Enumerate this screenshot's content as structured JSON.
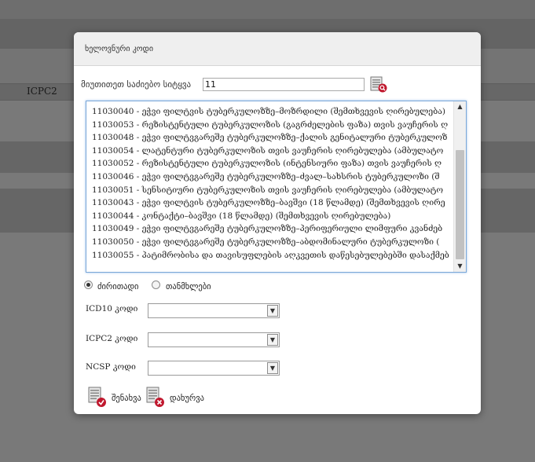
{
  "background": {
    "column_label": "ICPC2"
  },
  "dialog": {
    "title": "ხელოვნური კოდი",
    "search": {
      "label": "მიუთითეთ საძიებო სიტყვა",
      "value": "11"
    },
    "codes": [
      "11030040 - ეჭვი ფილტვის ტუბერკულოზზე–მოზრდილი (შემთხვევის ღირებულება)",
      "11030053 - რეზისტენტული ტუბერკულოზის (გაგრძელების ფაზა) თვის ვაუჩერის ღ",
      "11030048 - ეჭვი ფილტვგარეშე ტუბერკულოზზე–ქალის გენიტალური ტუბერკულოზ",
      "11030054 - ლატენტური ტუბერკულოზის თვის ვაუჩერის ღირებულება (ამბულატო",
      "11030052 - რეზისტენტული ტუბერკულოზის (ინტენსიური ფაზა) თვის ვაუჩერის ღ",
      "11030046 - ეჭვი ფილტვგარეშე ტუბერკულოზზე–ძვალ–სახსრის ტუბერკულოზი (შ",
      "11030051 - სენსიტიური ტუბერკულოზის თვის ვაუჩერის ღირებულება (ამბულატო",
      "11030043 - ეჭვი ფილტვის ტუბერკულოზზე–ბავშვი (18 წლამდე) (შემთხვევის ღირე",
      "11030044 - კონტაქტი–ბავშვი (18 წლამდე) (შემთხვევის ღირებულება)",
      "11030049 - ეჭვი ფილტვგარეშე ტუბერკულოზზე–პერიფერიული ლიმფური კვანძებ",
      "11030050 - ეჭვი ფილტვგარეშე ტუბერკულოზზე–აბდომინალური ტუბერკულოზი (",
      "11030055 - პატიმრობისა და თავისუფლების აღკვეთის დაწესებულებებში დასაქმებ"
    ],
    "radio": {
      "primary_label": "ძირითადი",
      "secondary_label": "თანმხლები",
      "selected": "primary"
    },
    "fields": {
      "icd10_label": "ICD10 კოდი",
      "icpc2_label": "ICPC2 კოდი",
      "ncsp_label": "NCSP კოდი",
      "icd10_value": "",
      "icpc2_value": "",
      "ncsp_value": ""
    },
    "actions": {
      "save_label": "შენახვა",
      "close_label": "დახურვა"
    }
  },
  "icons": {
    "search": "search-icon",
    "save": "save-icon",
    "close": "close-icon"
  },
  "colors": {
    "list_focus_border": "#7aa7d8",
    "icon_red": "#c0182e",
    "overlay": "#000000"
  }
}
